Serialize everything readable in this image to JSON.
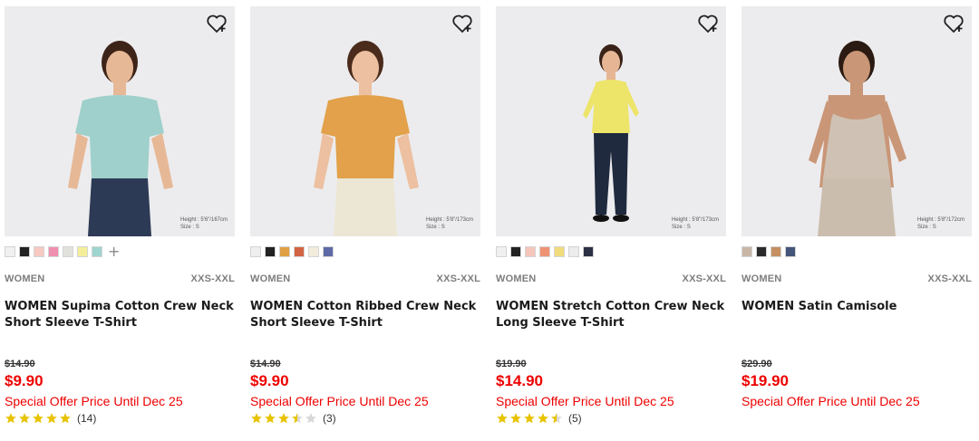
{
  "colors": {
    "price_red": "#e00000",
    "star_gold": "#e8c300",
    "star_empty": "#d8d8d8"
  },
  "products": [
    {
      "category": "WOMEN",
      "sizes": "XXS-XXL",
      "name": "WOMEN Supima Cotton Crew Neck Short Sleeve T-Shirt",
      "old_price": "$14.90",
      "price": "$9.90",
      "offer": "Special Offer Price Until Dec 25",
      "rating": 5,
      "review_count": "(14)",
      "height_info": [
        "Height : 5'6\"/167cm",
        "Size : S"
      ],
      "swatches": [
        "#f0f0f0",
        "#222222",
        "#f6c9c2",
        "#ef8fb0",
        "#e2e2dc",
        "#f4ee9a",
        "#9fd5cf"
      ],
      "more_swatches": "+",
      "garment_color": "#9fd0cb",
      "bottom_color": "#2d3a55",
      "skin": "#e7b896",
      "hair": "#3d2418"
    },
    {
      "category": "WOMEN",
      "sizes": "XXS-XXL",
      "name": "WOMEN Cotton Ribbed Crew Neck Short Sleeve T-Shirt",
      "old_price": "$14.90",
      "price": "$9.90",
      "offer": "Special Offer Price Until Dec 25",
      "rating": 3.5,
      "review_count": "(3)",
      "height_info": [
        "Height : 5'8\"/173cm",
        "Size : S"
      ],
      "swatches": [
        "#eeeeee",
        "#222222",
        "#e0a043",
        "#d26444",
        "#f3ecdc",
        "#5e6aa6"
      ],
      "garment_color": "#e2a14a",
      "bottom_color": "#ece6d4",
      "skin": "#ecc0a0",
      "hair": "#4a2b1c"
    },
    {
      "category": "WOMEN",
      "sizes": "XXS-XXL",
      "name": "WOMEN Stretch Cotton Crew Neck Long Sleeve T-Shirt",
      "old_price": "$19.90",
      "price": "$14.90",
      "offer": "Special Offer Price Until Dec 25",
      "rating": 4.5,
      "review_count": "(5)",
      "height_info": [
        "Height : 5'8\"/173cm",
        "Size : S"
      ],
      "swatches": [
        "#f0f0f0",
        "#222222",
        "#f6c6bc",
        "#ee9374",
        "#f1dc7c",
        "#ececec",
        "#2c3145"
      ],
      "garment_color": "#ede46a",
      "bottom_color": "#1f2a3e",
      "skin": "#e6b694",
      "hair": "#3a2218"
    },
    {
      "category": "WOMEN",
      "sizes": "XXS-XXL",
      "name": "WOMEN Satin Camisole",
      "old_price": "$29.90",
      "price": "$19.90",
      "offer": "Special Offer Price Until Dec 25",
      "rating": 0,
      "review_count": "",
      "height_info": [
        "Height : 5'8\"/172cm",
        "Size : S"
      ],
      "swatches": [
        "#c8b7a7",
        "#2a2a2a",
        "#c58f62",
        "#44557a"
      ],
      "garment_color": "#cfc2b4",
      "bottom_color": "#cbbdad",
      "skin": "#c99677",
      "hair": "#2a1a12"
    }
  ]
}
